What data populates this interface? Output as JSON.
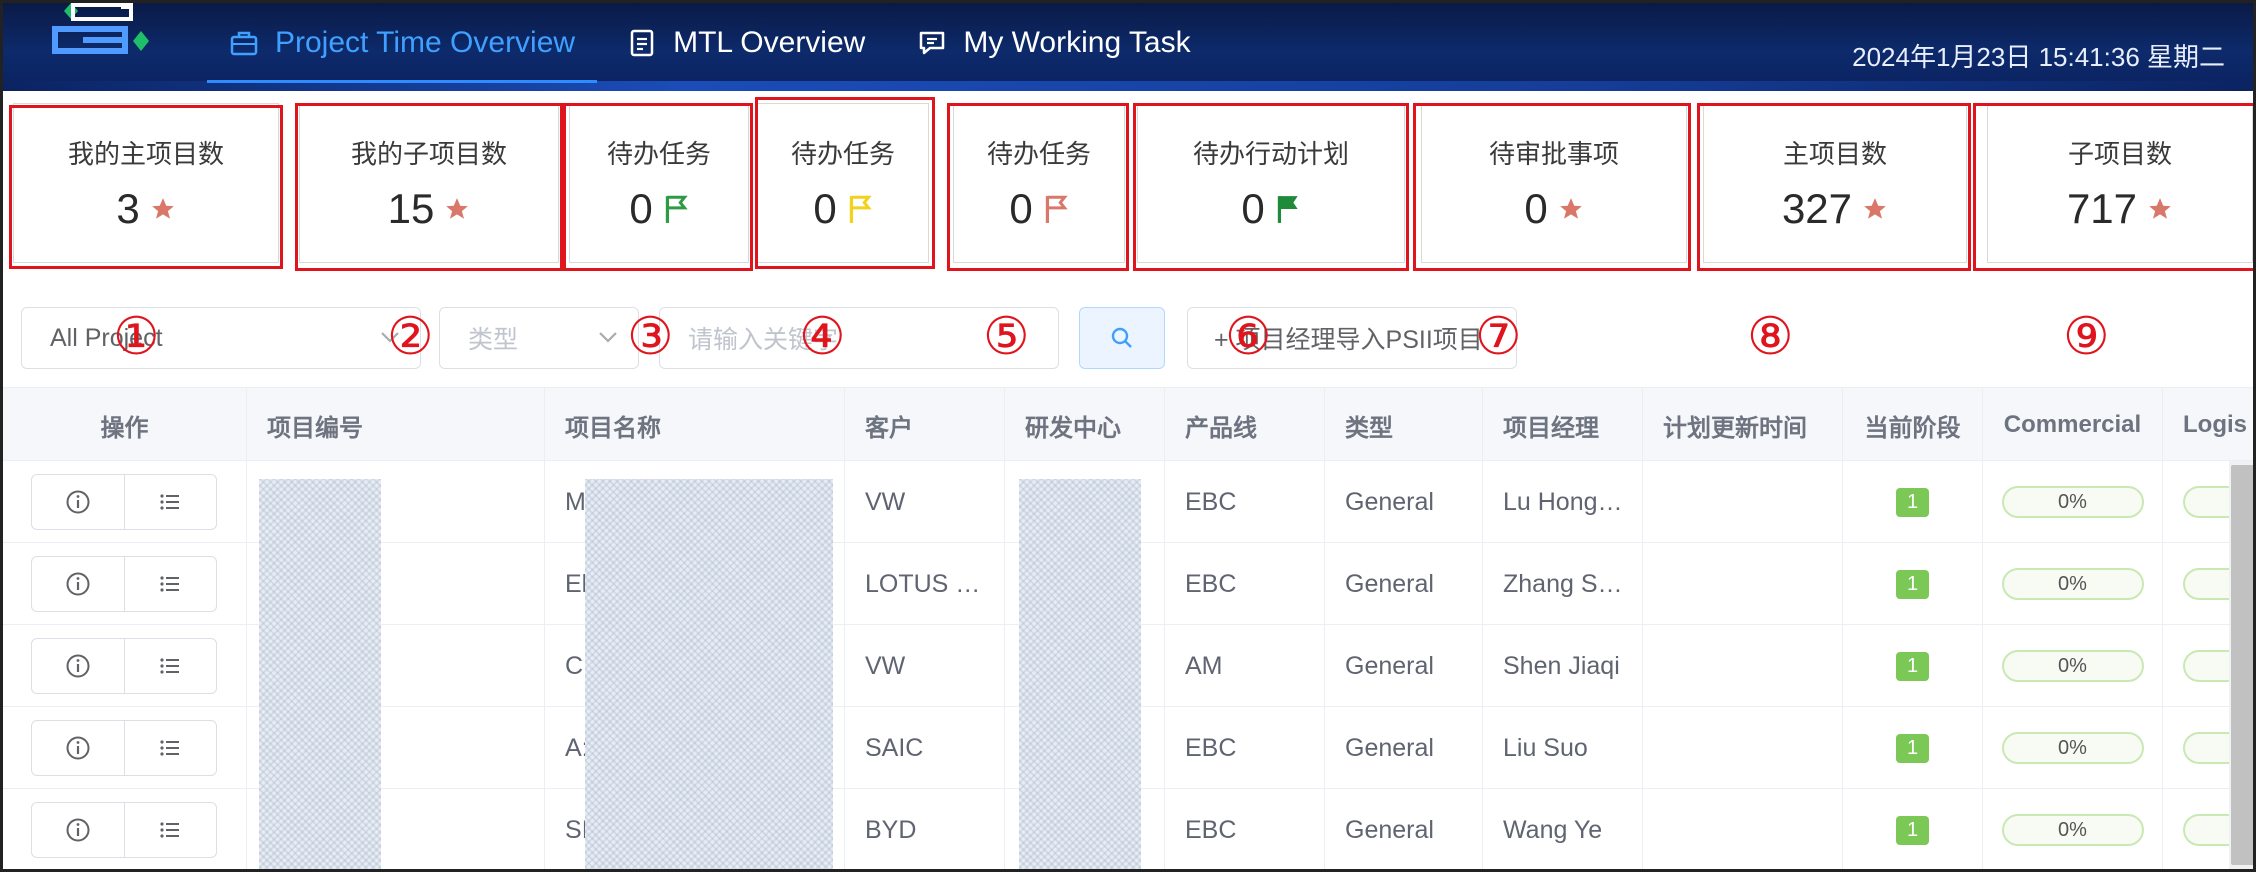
{
  "header": {
    "nav": [
      {
        "label": "Project Time Overview",
        "icon": "briefcase-icon",
        "active": true
      },
      {
        "label": "MTL Overview",
        "icon": "document-icon",
        "active": false
      },
      {
        "label": "My Working Task",
        "icon": "comment-icon",
        "active": false
      }
    ],
    "datetime": "2024年1月23日  15:41:36  星期二"
  },
  "cards": [
    {
      "title": "我的主项目数",
      "value": "3",
      "icon": "star-icon",
      "icon_color": "#d9776a"
    },
    {
      "title": "我的子项目数",
      "value": "15",
      "icon": "star-icon",
      "icon_color": "#d9776a"
    },
    {
      "title": "待办任务",
      "value": "0",
      "icon": "flag-outline-icon",
      "icon_color": "#2e9a43"
    },
    {
      "title": "待办任务",
      "value": "0",
      "icon": "flag-outline-icon",
      "icon_color": "#f2d21a"
    },
    {
      "title": "待办任务",
      "value": "0",
      "icon": "flag-outline-icon",
      "icon_color": "#d9776a"
    },
    {
      "title": "待办行动计划",
      "value": "0",
      "icon": "flag-filled-icon",
      "icon_color": "#1f8a3a"
    },
    {
      "title": "待审批事项",
      "value": "0",
      "icon": "star-icon",
      "icon_color": "#d9776a"
    },
    {
      "title": "主项目数",
      "value": "327",
      "icon": "star-icon",
      "icon_color": "#d9776a"
    },
    {
      "title": "子项目数",
      "value": "717",
      "icon": "star-icon",
      "icon_color": "#d9776a"
    }
  ],
  "filters": {
    "project_select": "All Project",
    "type_placeholder": "类型",
    "keyword_placeholder": "请输入关键字",
    "import_label": "+ 项目经理导入PSII项目"
  },
  "annotations": [
    "①",
    "②",
    "③",
    "④",
    "⑤",
    "⑥",
    "⑦",
    "⑧",
    "⑨"
  ],
  "table": {
    "columns": [
      "操作",
      "项目编号",
      "项目名称",
      "客户",
      "研发中心",
      "产品线",
      "类型",
      "项目经理",
      "计划更新时间",
      "当前阶段",
      "Commercial",
      "Logis"
    ],
    "rows": [
      {
        "name": "M",
        "customer": "VW",
        "product_line": "EBC",
        "type": "General",
        "manager": "Lu Hong…",
        "stage": "1",
        "commercial": "0%"
      },
      {
        "name": "El",
        "customer": "LOTUS …",
        "product_line": "EBC",
        "type": "General",
        "manager": "Zhang S…",
        "stage": "1",
        "commercial": "0%"
      },
      {
        "name": "C",
        "customer": "VW",
        "product_line": "AM",
        "type": "General",
        "manager": "Shen Jiaqi",
        "stage": "1",
        "commercial": "0%"
      },
      {
        "name": "A:",
        "customer": "SAIC",
        "product_line": "EBC",
        "type": "General",
        "manager": "Liu Suo",
        "stage": "1",
        "commercial": "0%"
      },
      {
        "name": "SI",
        "customer": "BYD",
        "product_line": "EBC",
        "type": "General",
        "manager": "Wang Ye",
        "stage": "1",
        "commercial": "0%"
      }
    ]
  }
}
